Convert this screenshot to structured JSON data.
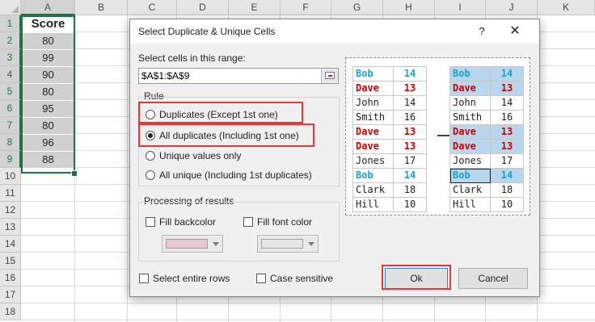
{
  "sheet": {
    "columns": [
      "A",
      "B",
      "C",
      "D",
      "E",
      "F",
      "G",
      "H",
      "I",
      "J",
      "K"
    ],
    "rows": [
      "1",
      "2",
      "3",
      "4",
      "5",
      "6",
      "7",
      "8",
      "9",
      "10",
      "11",
      "12",
      "13",
      "14",
      "15",
      "16",
      "17",
      "18"
    ],
    "cells_a": [
      "Score",
      "80",
      "99",
      "90",
      "80",
      "95",
      "80",
      "96",
      "88"
    ]
  },
  "dialog": {
    "title": "Select Duplicate & Unique Cells",
    "help": "?",
    "close": "✕",
    "range_label": "Select cells in this range:",
    "range_value": "$A$1:$A$9",
    "rule_label": "Rule",
    "rules": [
      "Duplicates (Except 1st one)",
      "All duplicates (Including 1st one)",
      "Unique values only",
      "All unique (Including 1st duplicates)"
    ],
    "selected_rule": "All duplicates (Including 1st one)",
    "processing_label": "Processing of results",
    "fill_backcolor": "Fill backcolor",
    "fill_font_color": "Fill font color",
    "backcolor_swatch": "#e8c8d0",
    "fontcolor_swatch": "#e6e6e6",
    "select_rows": "Select entire rows",
    "case_sensitive": "Case sensitive",
    "ok": "Ok",
    "cancel": "Cancel"
  },
  "preview": {
    "left": [
      {
        "name": "Bob",
        "value": "14",
        "style": "blue"
      },
      {
        "name": "Dave",
        "value": "13",
        "style": "red"
      },
      {
        "name": "John",
        "value": "14",
        "style": "plain"
      },
      {
        "name": "Smith",
        "value": "16",
        "style": "plain"
      },
      {
        "name": "Dave",
        "value": "13",
        "style": "red"
      },
      {
        "name": "Dave",
        "value": "13",
        "style": "red"
      },
      {
        "name": "Jones",
        "value": "17",
        "style": "plain"
      },
      {
        "name": "Bob",
        "value": "14",
        "style": "blue"
      },
      {
        "name": "Clark",
        "value": "18",
        "style": "plain"
      },
      {
        "name": "Hill",
        "value": "10",
        "style": "plain"
      }
    ],
    "right": [
      {
        "name": "Bob",
        "value": "14",
        "style": "blue",
        "hl": true
      },
      {
        "name": "Dave",
        "value": "13",
        "style": "red",
        "hl": true
      },
      {
        "name": "John",
        "value": "14",
        "style": "plain",
        "hl": false
      },
      {
        "name": "Smith",
        "value": "16",
        "style": "plain",
        "hl": false
      },
      {
        "name": "Dave",
        "value": "13",
        "style": "red",
        "hl": true
      },
      {
        "name": "Dave",
        "value": "13",
        "style": "red",
        "hl": true
      },
      {
        "name": "Jones",
        "value": "17",
        "style": "plain",
        "hl": false
      },
      {
        "name": "Bob",
        "value": "14",
        "style": "blue",
        "hl": true
      },
      {
        "name": "Clark",
        "value": "18",
        "style": "plain",
        "hl": false
      },
      {
        "name": "Hill",
        "value": "10",
        "style": "plain",
        "hl": false
      }
    ]
  }
}
